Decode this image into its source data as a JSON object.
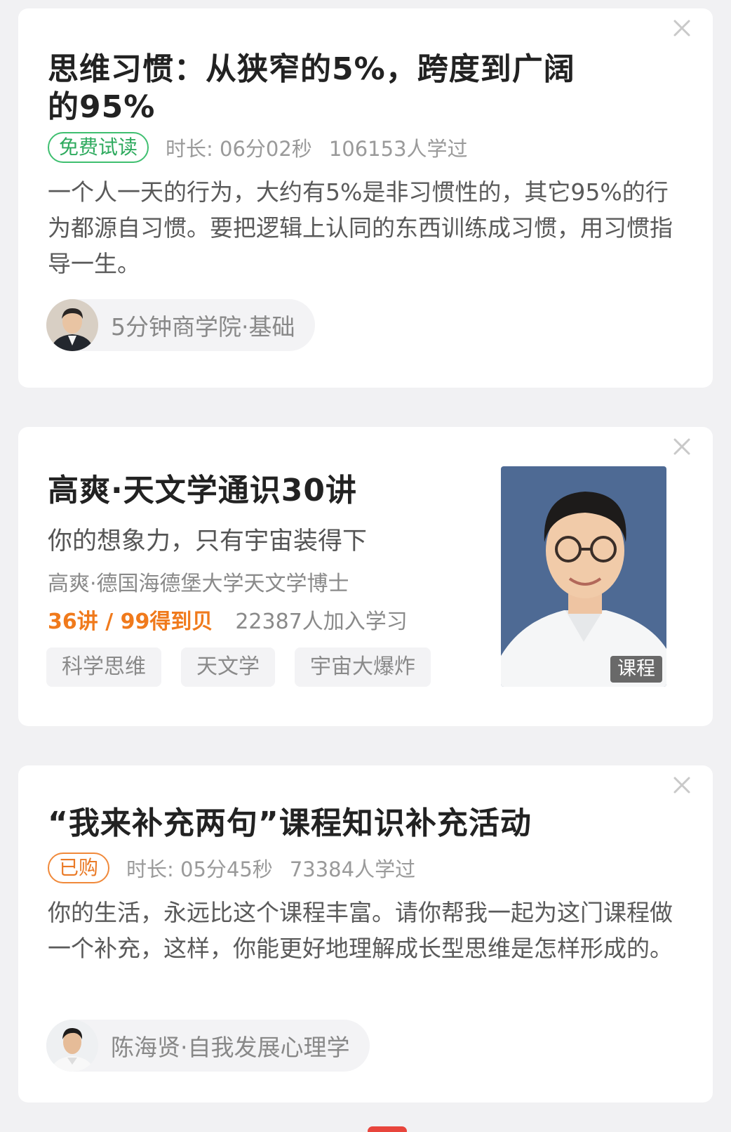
{
  "cards": [
    {
      "title": "思维习惯：从狭窄的5%，跨度到广阔的95%",
      "badge": "免费试读",
      "duration": "时长: 06分02秒",
      "learners": "106153人学过",
      "description": "一个人一天的行为，大约有5%是非习惯性的，其它95%的行为都源自习惯。要把逻辑上认同的东西训练成习惯，用习惯指导一生。",
      "author": "5分钟商学院·基础"
    },
    {
      "title": "高爽·天文学通识30讲",
      "subtitle": "你的想象力，只有宇宙装得下",
      "teacher": "高爽·德国海德堡大学天文学博士",
      "price": "36讲 / 99得到贝",
      "learners": "22387人加入学习",
      "tags": [
        "科学思维",
        "天文学",
        "宇宙大爆炸"
      ],
      "image_label": "课程"
    },
    {
      "title": "“我来补充两句”课程知识补充活动",
      "badge": "已购",
      "duration": "时长: 05分45秒",
      "learners": "73384人学过",
      "description": "你的生活，永远比这个课程丰富。请你帮我一起为这门课程做一个补充，这样，你能更好地理解成长型思维是怎样形成的。",
      "author": "陈海贤·自我发展心理学"
    }
  ],
  "colors": {
    "free_badge": "#2eaa5e",
    "purchased_badge": "#ea7a26",
    "price": "#f07a1c"
  },
  "icons": {
    "close": "close-icon"
  }
}
